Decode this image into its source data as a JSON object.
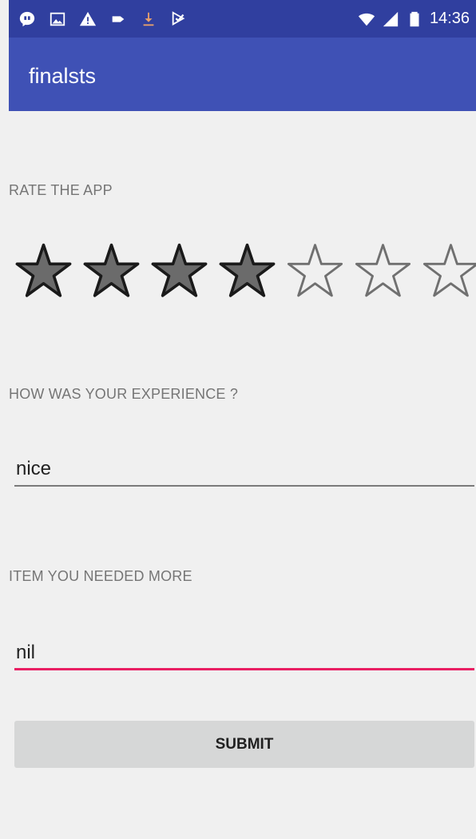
{
  "status_bar": {
    "time": "14:36",
    "left_icons": [
      "chat-icon",
      "image-icon",
      "warning-icon",
      "label-icon",
      "download-icon",
      "checkbox-icon"
    ],
    "right_icons": [
      "wifi-icon",
      "signal-icon",
      "battery-icon"
    ]
  },
  "app_bar": {
    "title": "finalsts",
    "color": "#3f51b5",
    "status_color": "#303f9f"
  },
  "rating": {
    "label": "RATE THE APP",
    "value": 4,
    "max": 8
  },
  "experience": {
    "label": "HOW WAS YOUR EXPERIENCE ?",
    "value": "nice"
  },
  "item_needed": {
    "label": "ITEM YOU NEEDED MORE",
    "value": "nil",
    "focused": true,
    "accent": "#e91e63"
  },
  "submit": {
    "label": "SUBMIT"
  }
}
